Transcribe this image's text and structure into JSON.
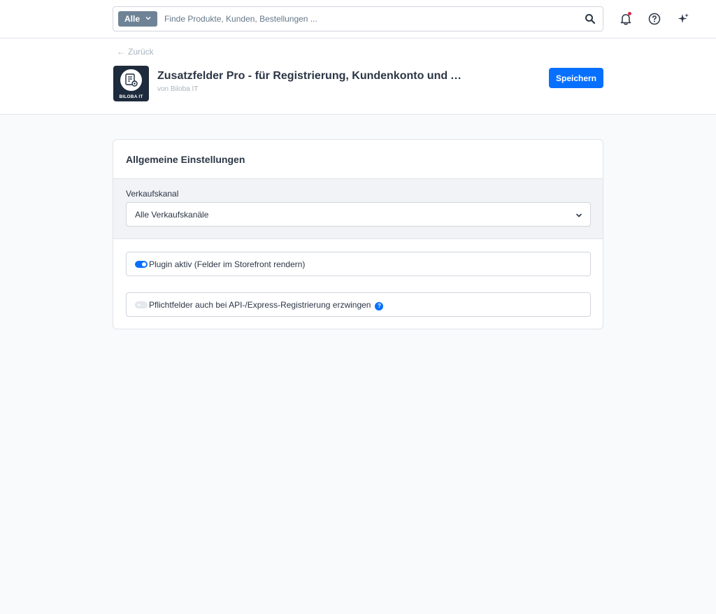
{
  "topbar": {
    "search_type_label": "Alle",
    "search_placeholder": "Finde Produkte, Kunden, Bestellungen ..."
  },
  "header": {
    "back_label": "Zurück",
    "back_arrow": "←",
    "plugin_title": "Zusatzfelder Pro - für Registrierung, Kundenkonto und Adr...",
    "plugin_vendor": "von Biloba IT",
    "logo_text": "BILOBA IT",
    "save_label": "Speichern"
  },
  "card": {
    "title": "Allgemeine Einstellungen",
    "sales_channel": {
      "label": "Verkaufskanal",
      "value": "Alle Verkaufskanäle"
    },
    "fields": [
      {
        "label": "Plugin aktiv (Felder im Storefront rendern)",
        "enabled": true
      },
      {
        "label": "Pflichtfelder auch bei API-/Express-Registrierung erzwingen",
        "enabled": false,
        "help_icon": "?"
      }
    ]
  },
  "colors": {
    "primary": "#0870ff",
    "notification_dot": "#de294c",
    "search_type_bg": "#6f8396"
  }
}
